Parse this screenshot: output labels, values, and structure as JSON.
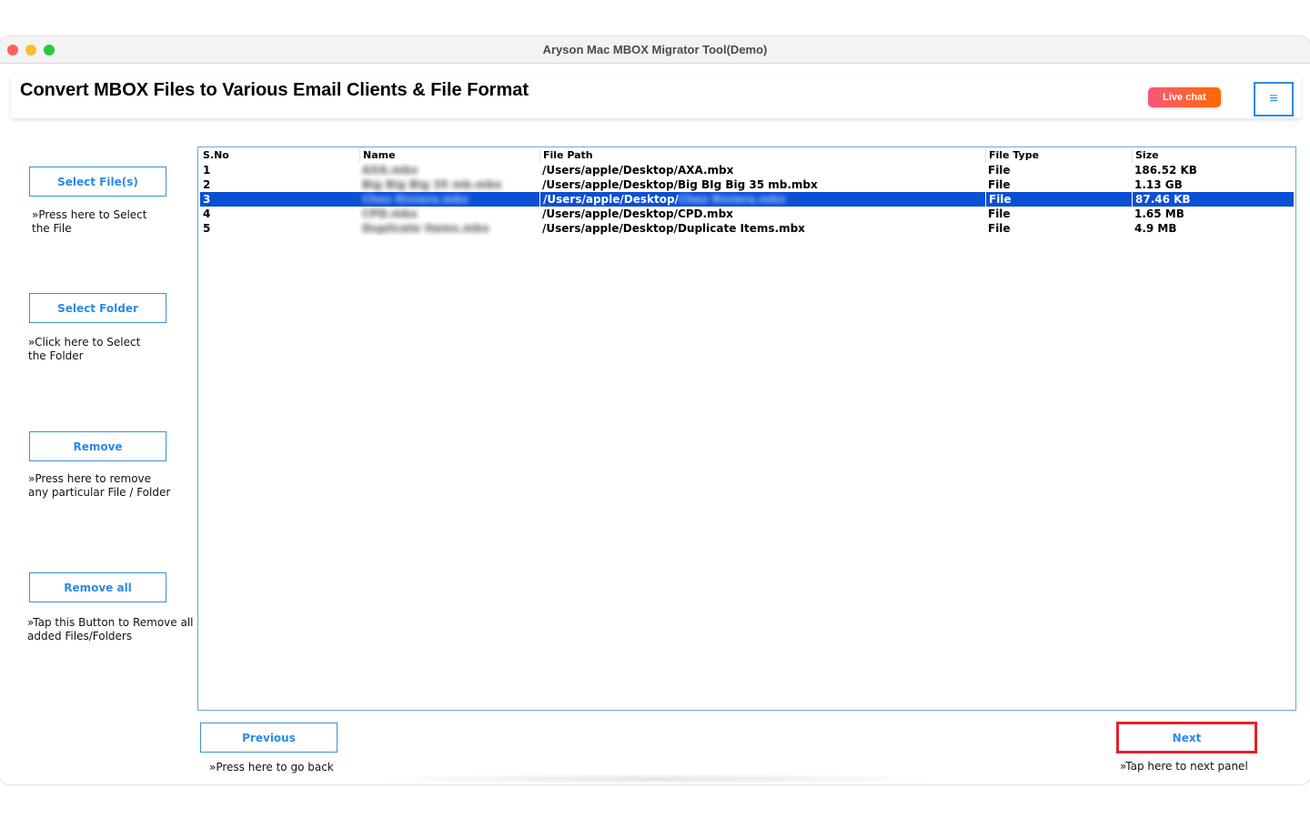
{
  "window": {
    "title": "Aryson Mac MBOX Migrator Tool(Demo)"
  },
  "header": {
    "title": "Convert MBOX Files to Various Email Clients & File Format",
    "live_chat_label": "Live chat",
    "menu_icon": "≡"
  },
  "sidebar": {
    "select_files": {
      "label": "Select File(s)",
      "hint": "»Press here to Select the File"
    },
    "select_folder": {
      "label": "Select Folder",
      "hint": "»Click here to Select the Folder"
    },
    "remove": {
      "label": "Remove",
      "hint": "»Press here to remove any particular File / Folder"
    },
    "remove_all": {
      "label": "Remove all",
      "hint": "»Tap this Button to Remove all added Files/Folders"
    }
  },
  "table": {
    "columns": [
      "S.No",
      "Name",
      "File Path",
      "File Type",
      "Size"
    ],
    "selected_row": 2,
    "rows": [
      {
        "sno": "1",
        "name": "AXA.mbx",
        "path": "/Users/apple/Desktop/AXA.mbx",
        "path_prefix": "/Users/apple/Desktop/AXA.mbx",
        "path_blur": "",
        "type": "File",
        "size": "186.52 KB"
      },
      {
        "sno": "2",
        "name": "Big Big Big 35 mb.mbx",
        "path": "/Users/apple/Desktop/Big BIg Big 35 mb.mbx",
        "path_prefix": "/Users/apple/Desktop/Big BIg Big 35 mb.mbx",
        "path_blur": "",
        "type": "File",
        "size": "1.13 GB"
      },
      {
        "sno": "3",
        "name": "Chez Riviera.mbx",
        "path": "/Users/apple/Desktop/",
        "path_prefix": "/Users/apple/Desktop/",
        "path_blur": "Chez Riviera.mbx",
        "type": "File",
        "size": "87.46 KB"
      },
      {
        "sno": "4",
        "name": "CPD.mbx",
        "path": "/Users/apple/Desktop/CPD.mbx",
        "path_prefix": "/Users/apple/Desktop/CPD.mbx",
        "path_blur": "",
        "type": "File",
        "size": "1.65 MB"
      },
      {
        "sno": "5",
        "name": "Duplicate Items.mbx",
        "path": "/Users/apple/Desktop/Duplicate Items.mbx",
        "path_prefix": "/Users/apple/Desktop/Duplicate Items.mbx",
        "path_blur": "",
        "type": "File",
        "size": "4.9 MB"
      }
    ]
  },
  "navigation": {
    "previous_label": "Previous",
    "previous_hint": "»Press here to go back",
    "next_label": "Next",
    "next_hint": "»Tap here to next panel"
  },
  "colors": {
    "accent": "#2a8ae6",
    "selection": "#0b4fd4",
    "next_highlight": "#e3212b",
    "live_chat_start": "#f5577a",
    "live_chat_end": "#ff6a00"
  }
}
